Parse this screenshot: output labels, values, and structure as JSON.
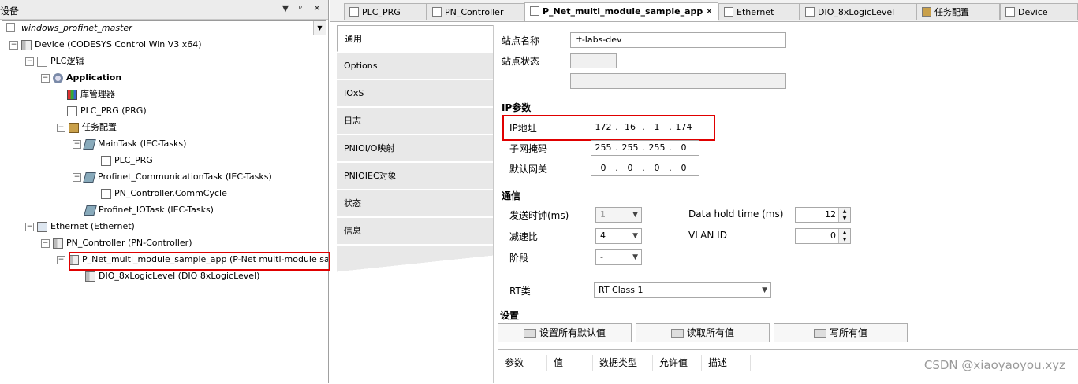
{
  "left_panel": {
    "title": "设备",
    "title_buttons": [
      "▼",
      "ᵖ",
      "✕"
    ],
    "combo_value": "windows_profinet_master",
    "tree": [
      {
        "label": "Device (CODESYS Control Win V3 x64)"
      },
      {
        "label": "PLC逻辑"
      },
      {
        "label": "Application"
      },
      {
        "label": "库管理器"
      },
      {
        "label": "PLC_PRG (PRG)"
      },
      {
        "label": "任务配置"
      },
      {
        "label": "MainTask (IEC-Tasks)"
      },
      {
        "label": "PLC_PRG"
      },
      {
        "label": "Profinet_CommunicationTask (IEC-Tasks)"
      },
      {
        "label": "PN_Controller.CommCycle"
      },
      {
        "label": "Profinet_IOTask (IEC-Tasks)"
      },
      {
        "label": "Ethernet (Ethernet)"
      },
      {
        "label": "PN_Controller (PN-Controller)"
      },
      {
        "label": "P_Net_multi_module_sample_app (P-Net multi-module sample ap"
      },
      {
        "label": "DIO_8xLogicLevel (DIO 8xLogicLevel)"
      }
    ]
  },
  "tabs": [
    {
      "label": "PLC_PRG"
    },
    {
      "label": "PN_Controller"
    },
    {
      "label": "P_Net_multi_module_sample_app",
      "close": "✕"
    },
    {
      "label": "Ethernet"
    },
    {
      "label": "DIO_8xLogicLevel"
    },
    {
      "label": "任务配置"
    },
    {
      "label": "Device"
    }
  ],
  "side_tabs": [
    "通用",
    "Options",
    "IOxS",
    "日志",
    "PNIOI/O映射",
    "PNIOIEC对象",
    "状态",
    "信息"
  ],
  "form": {
    "station_name_label": "站点名称",
    "station_name_value": "rt-labs-dev",
    "station_status_label": "站点状态",
    "ip_section": "IP参数",
    "ip_label": "IP地址",
    "ip_value": [
      "172",
      "16",
      "1",
      "174"
    ],
    "subnet_label": "子网掩码",
    "subnet_value": [
      "255",
      "255",
      "255",
      "0"
    ],
    "gateway_label": "默认网关",
    "gateway_value": [
      "0",
      "0",
      "0",
      "0"
    ],
    "comm_section": "通信",
    "send_clock_label": "发送时钟(ms)",
    "send_clock_value": "1",
    "reduction_label": "减速比",
    "reduction_value": "4",
    "phase_label": "阶段",
    "phase_value": "-",
    "data_hold_label": "Data hold time (ms)",
    "data_hold_value": "12",
    "vlan_label": "VLAN ID",
    "vlan_value": "0",
    "rt_class_label": "RT类",
    "rt_class_value": "RT Class 1",
    "settings_section": "设置",
    "btn_defaults": "设置所有默认值",
    "btn_read": "读取所有值",
    "btn_write": "写所有值",
    "grid_headers": [
      "参数",
      "值",
      "数据类型",
      "允许值",
      "描述"
    ]
  },
  "watermark": "CSDN @xiaoyaoyou.xyz",
  "colors": {
    "highlight_border": "#e00000",
    "tab_active": "#ffffff",
    "side_tab": "#e8e8e8"
  }
}
